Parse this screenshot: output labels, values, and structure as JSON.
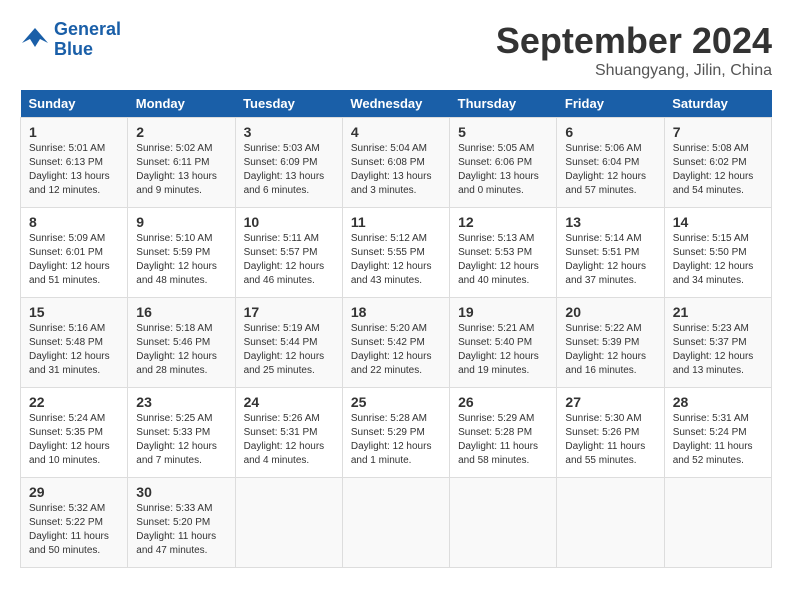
{
  "logo": {
    "text_general": "General",
    "text_blue": "Blue"
  },
  "header": {
    "month": "September 2024",
    "location": "Shuangyang, Jilin, China"
  },
  "weekdays": [
    "Sunday",
    "Monday",
    "Tuesday",
    "Wednesday",
    "Thursday",
    "Friday",
    "Saturday"
  ],
  "weeks": [
    [
      {
        "day": "1",
        "info": "Sunrise: 5:01 AM\nSunset: 6:13 PM\nDaylight: 13 hours\nand 12 minutes."
      },
      {
        "day": "2",
        "info": "Sunrise: 5:02 AM\nSunset: 6:11 PM\nDaylight: 13 hours\nand 9 minutes."
      },
      {
        "day": "3",
        "info": "Sunrise: 5:03 AM\nSunset: 6:09 PM\nDaylight: 13 hours\nand 6 minutes."
      },
      {
        "day": "4",
        "info": "Sunrise: 5:04 AM\nSunset: 6:08 PM\nDaylight: 13 hours\nand 3 minutes."
      },
      {
        "day": "5",
        "info": "Sunrise: 5:05 AM\nSunset: 6:06 PM\nDaylight: 13 hours\nand 0 minutes."
      },
      {
        "day": "6",
        "info": "Sunrise: 5:06 AM\nSunset: 6:04 PM\nDaylight: 12 hours\nand 57 minutes."
      },
      {
        "day": "7",
        "info": "Sunrise: 5:08 AM\nSunset: 6:02 PM\nDaylight: 12 hours\nand 54 minutes."
      }
    ],
    [
      {
        "day": "8",
        "info": "Sunrise: 5:09 AM\nSunset: 6:01 PM\nDaylight: 12 hours\nand 51 minutes."
      },
      {
        "day": "9",
        "info": "Sunrise: 5:10 AM\nSunset: 5:59 PM\nDaylight: 12 hours\nand 48 minutes."
      },
      {
        "day": "10",
        "info": "Sunrise: 5:11 AM\nSunset: 5:57 PM\nDaylight: 12 hours\nand 46 minutes."
      },
      {
        "day": "11",
        "info": "Sunrise: 5:12 AM\nSunset: 5:55 PM\nDaylight: 12 hours\nand 43 minutes."
      },
      {
        "day": "12",
        "info": "Sunrise: 5:13 AM\nSunset: 5:53 PM\nDaylight: 12 hours\nand 40 minutes."
      },
      {
        "day": "13",
        "info": "Sunrise: 5:14 AM\nSunset: 5:51 PM\nDaylight: 12 hours\nand 37 minutes."
      },
      {
        "day": "14",
        "info": "Sunrise: 5:15 AM\nSunset: 5:50 PM\nDaylight: 12 hours\nand 34 minutes."
      }
    ],
    [
      {
        "day": "15",
        "info": "Sunrise: 5:16 AM\nSunset: 5:48 PM\nDaylight: 12 hours\nand 31 minutes."
      },
      {
        "day": "16",
        "info": "Sunrise: 5:18 AM\nSunset: 5:46 PM\nDaylight: 12 hours\nand 28 minutes."
      },
      {
        "day": "17",
        "info": "Sunrise: 5:19 AM\nSunset: 5:44 PM\nDaylight: 12 hours\nand 25 minutes."
      },
      {
        "day": "18",
        "info": "Sunrise: 5:20 AM\nSunset: 5:42 PM\nDaylight: 12 hours\nand 22 minutes."
      },
      {
        "day": "19",
        "info": "Sunrise: 5:21 AM\nSunset: 5:40 PM\nDaylight: 12 hours\nand 19 minutes."
      },
      {
        "day": "20",
        "info": "Sunrise: 5:22 AM\nSunset: 5:39 PM\nDaylight: 12 hours\nand 16 minutes."
      },
      {
        "day": "21",
        "info": "Sunrise: 5:23 AM\nSunset: 5:37 PM\nDaylight: 12 hours\nand 13 minutes."
      }
    ],
    [
      {
        "day": "22",
        "info": "Sunrise: 5:24 AM\nSunset: 5:35 PM\nDaylight: 12 hours\nand 10 minutes."
      },
      {
        "day": "23",
        "info": "Sunrise: 5:25 AM\nSunset: 5:33 PM\nDaylight: 12 hours\nand 7 minutes."
      },
      {
        "day": "24",
        "info": "Sunrise: 5:26 AM\nSunset: 5:31 PM\nDaylight: 12 hours\nand 4 minutes."
      },
      {
        "day": "25",
        "info": "Sunrise: 5:28 AM\nSunset: 5:29 PM\nDaylight: 12 hours\nand 1 minute."
      },
      {
        "day": "26",
        "info": "Sunrise: 5:29 AM\nSunset: 5:28 PM\nDaylight: 11 hours\nand 58 minutes."
      },
      {
        "day": "27",
        "info": "Sunrise: 5:30 AM\nSunset: 5:26 PM\nDaylight: 11 hours\nand 55 minutes."
      },
      {
        "day": "28",
        "info": "Sunrise: 5:31 AM\nSunset: 5:24 PM\nDaylight: 11 hours\nand 52 minutes."
      }
    ],
    [
      {
        "day": "29",
        "info": "Sunrise: 5:32 AM\nSunset: 5:22 PM\nDaylight: 11 hours\nand 50 minutes."
      },
      {
        "day": "30",
        "info": "Sunrise: 5:33 AM\nSunset: 5:20 PM\nDaylight: 11 hours\nand 47 minutes."
      },
      {
        "day": "",
        "info": ""
      },
      {
        "day": "",
        "info": ""
      },
      {
        "day": "",
        "info": ""
      },
      {
        "day": "",
        "info": ""
      },
      {
        "day": "",
        "info": ""
      }
    ]
  ]
}
